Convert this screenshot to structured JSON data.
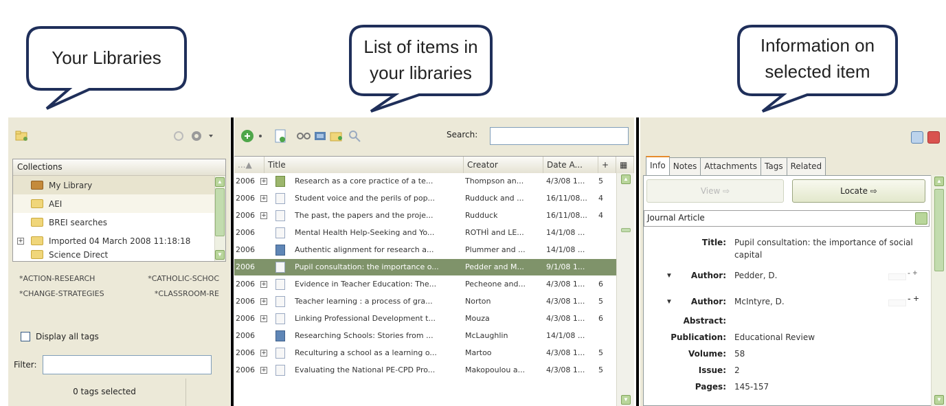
{
  "callouts": {
    "libraries": "Your Libraries",
    "items_line1": "List of items in",
    "items_line2": "your libraries",
    "info_line1": "Information on",
    "info_line2": "selected item"
  },
  "left": {
    "collections_header": "Collections",
    "collections": [
      {
        "label": "My Library"
      },
      {
        "label": "AEI"
      },
      {
        "label": "BREI searches"
      },
      {
        "label": "Imported 04 March 2008 11:18:18"
      },
      {
        "label": "Science Direct"
      }
    ],
    "tags_row1": [
      "*ACTION-RESEARCH",
      "*CATHOLIC-SCHOC"
    ],
    "tags_row2": [
      "*CHANGE-STRATEGIES",
      "*CLASSROOM-RE"
    ],
    "display_all_tags": "Display all tags",
    "filter_label": "Filter:",
    "tags_selected": "0 tags selected"
  },
  "middle": {
    "search_label": "Search:",
    "columns": {
      "title": "Title",
      "creator": "Creator",
      "date": "Date A...",
      "plus": "+"
    },
    "rows": [
      {
        "year": "2006",
        "title": "Research as a core practice of a te...",
        "creator": "Thompson an...",
        "date": "4/3/08 1...",
        "num": "5",
        "icon": "web",
        "exp": true
      },
      {
        "year": "2006",
        "title": "Student voice and the perils of pop...",
        "creator": "Rudduck and ...",
        "date": "16/11/08...",
        "num": "4",
        "icon": "doc",
        "exp": true
      },
      {
        "year": "2006",
        "title": "The past, the papers and the proje...",
        "creator": "Rudduck",
        "date": "16/11/08...",
        "num": "4",
        "icon": "doc",
        "exp": true
      },
      {
        "year": "2006",
        "title": "Mental Health Help-Seeking and Yo...",
        "creator": "ROTHÌ and LE...",
        "date": "14/1/08 ...",
        "num": "",
        "icon": "doc",
        "exp": false
      },
      {
        "year": "2006",
        "title": "Authentic alignment for research a...",
        "creator": "Plummer and ...",
        "date": "14/1/08 ...",
        "num": "",
        "icon": "book",
        "exp": false
      },
      {
        "year": "2006",
        "title": "Pupil consultation: the importance o...",
        "creator": "Pedder and M...",
        "date": "9/1/08 1...",
        "num": "",
        "icon": "doc",
        "exp": false
      },
      {
        "year": "2006",
        "title": "Evidence in Teacher Education: The...",
        "creator": "Pecheone and...",
        "date": "4/3/08 1...",
        "num": "6",
        "icon": "doc",
        "exp": true
      },
      {
        "year": "2006",
        "title": "Teacher learning : a process of gra...",
        "creator": "Norton",
        "date": "4/3/08 1...",
        "num": "5",
        "icon": "doc",
        "exp": true
      },
      {
        "year": "2006",
        "title": "Linking Professional Development t...",
        "creator": "Mouza",
        "date": "4/3/08 1...",
        "num": "6",
        "icon": "doc",
        "exp": true
      },
      {
        "year": "2006",
        "title": "Researching Schools: Stories from ...",
        "creator": "McLaughlin",
        "date": "14/1/08 ...",
        "num": "",
        "icon": "book",
        "exp": false
      },
      {
        "year": "2006",
        "title": "Reculturing a school as a learning o...",
        "creator": "Martoo",
        "date": "4/3/08 1...",
        "num": "5",
        "icon": "doc",
        "exp": true
      },
      {
        "year": "2006",
        "title": "Evaluating the National PE-CPD Pro...",
        "creator": "Makopoulou a...",
        "date": "4/3/08 1...",
        "num": "5",
        "icon": "doc",
        "exp": true
      }
    ],
    "selected_index": 5
  },
  "right": {
    "tabs": [
      "Info",
      "Notes",
      "Attachments",
      "Tags",
      "Related"
    ],
    "view_button": "View ⇨",
    "locate_button": "Locate ⇨",
    "item_type": "Journal Article",
    "fields": {
      "title_label": "Title:",
      "title_line1": "Pupil consultation: the importance of social",
      "title_line2": "capital",
      "author_label": "Author:",
      "author1": "Pedder,  D.",
      "author2": "McIntyre,  D.",
      "abstract_label": "Abstract:",
      "publication_label": "Publication:",
      "publication": "Educational Review",
      "volume_label": "Volume:",
      "volume": "58",
      "issue_label": "Issue:",
      "issue": "2",
      "pages_label": "Pages:",
      "pages": "145-157"
    },
    "minus_plus": "- +"
  }
}
